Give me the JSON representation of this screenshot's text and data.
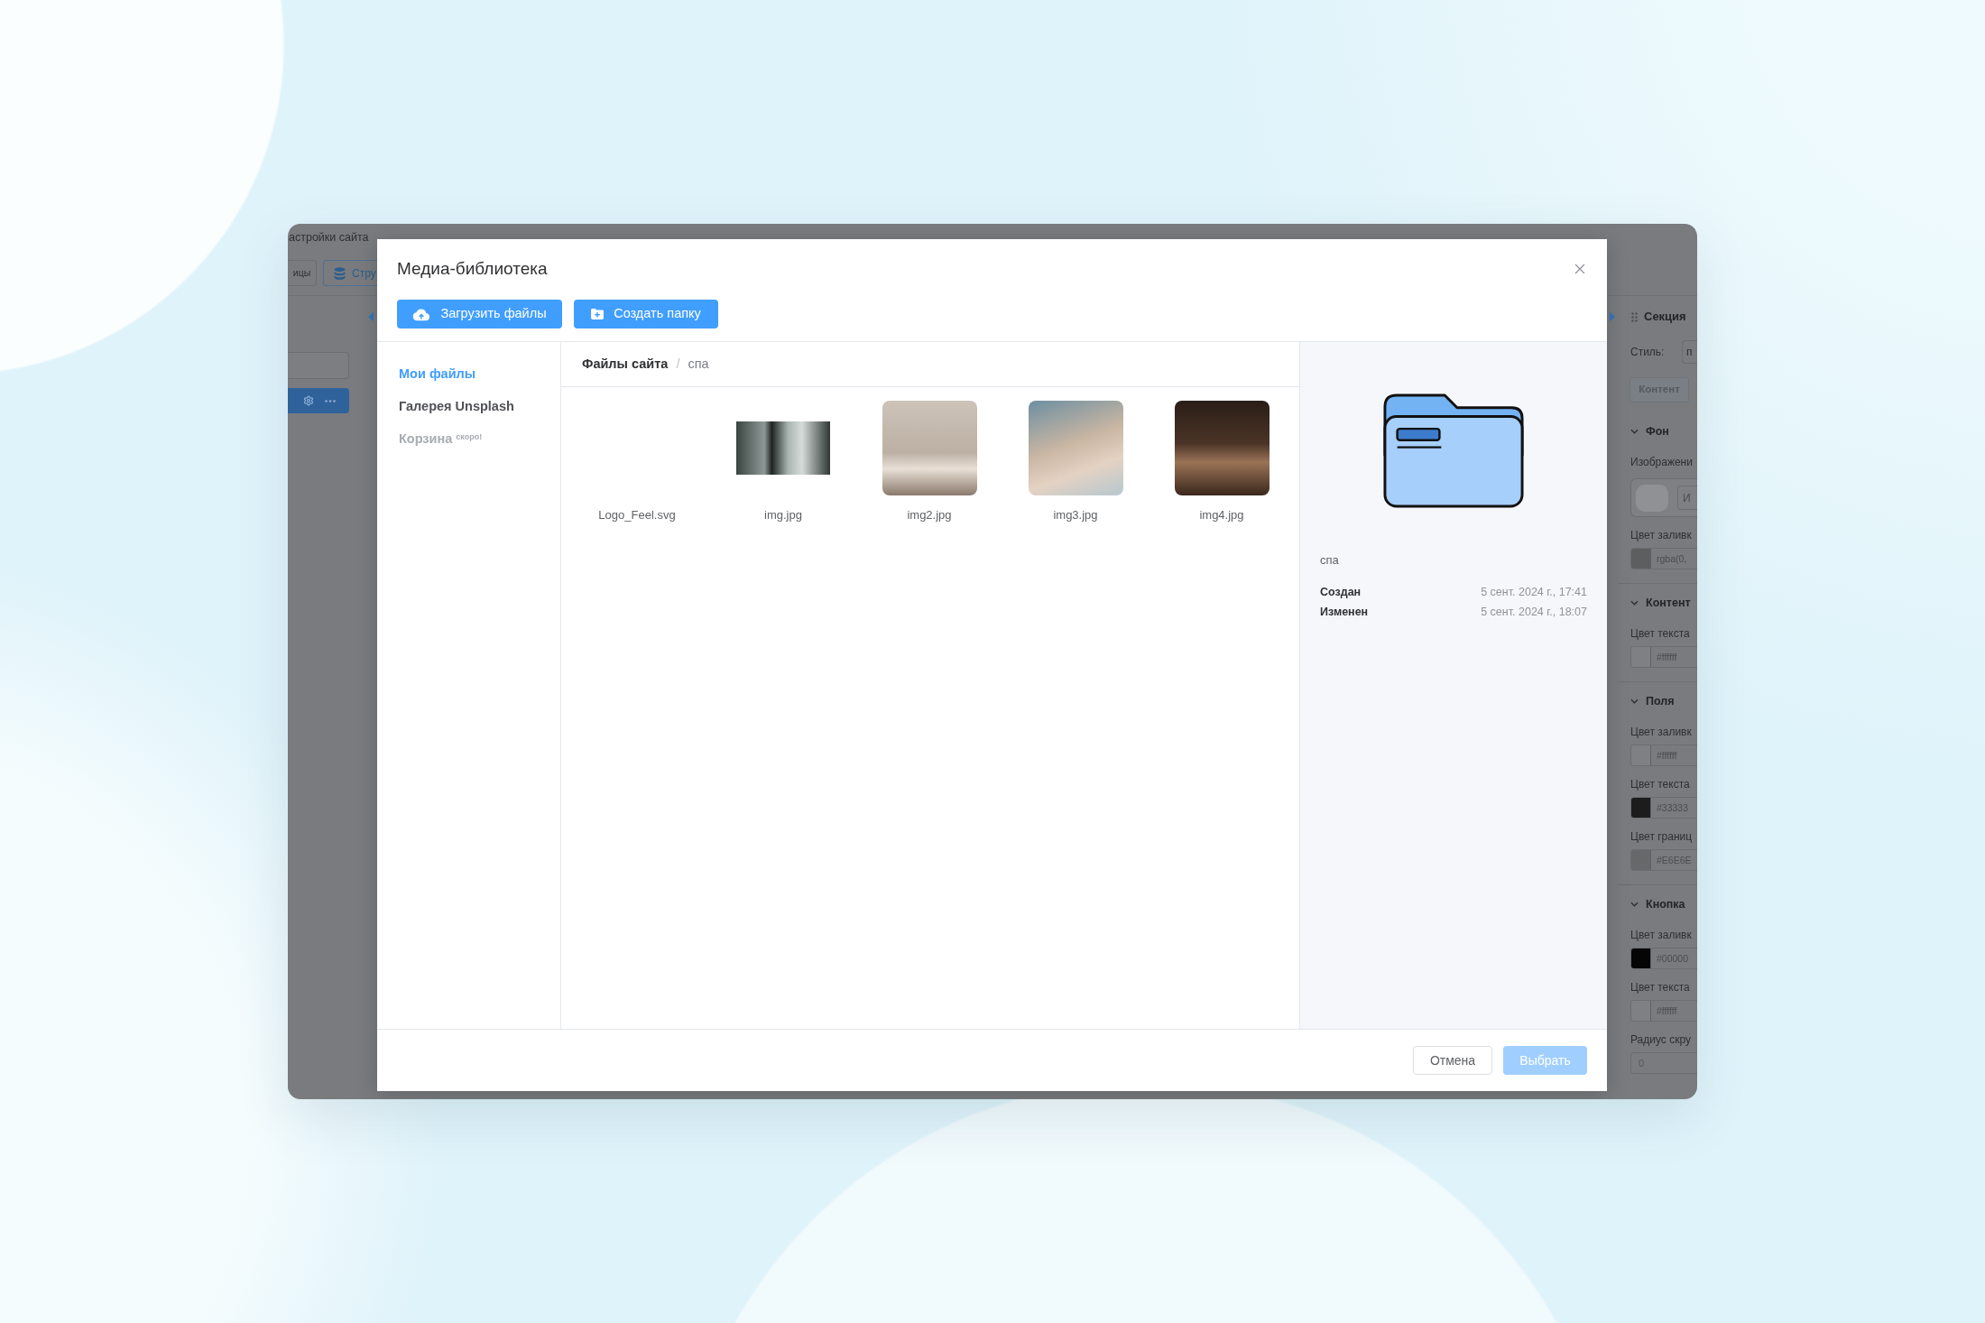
{
  "background_app": {
    "top_bar_title": "астройки сайта",
    "toolbar_buttons": [
      {
        "label": "ицы",
        "kind": "plain"
      },
      {
        "label": "Стру",
        "kind": "layers"
      }
    ],
    "settings_panel": {
      "title": "Секция",
      "style_label": "Стиль:",
      "style_value": "п",
      "tab": "Контент",
      "sections": [
        {
          "title": "Фон",
          "expanded": true,
          "fields": [
            {
              "kind": "image",
              "label": "Изображени",
              "value": "И"
            },
            {
              "kind": "color",
              "label": "Цвет заливк",
              "value": "rgba(0,",
              "color": "#5d5e60"
            }
          ]
        },
        {
          "title": "Контент",
          "expanded": true,
          "fields": [
            {
              "kind": "color",
              "label": "Цвет текста",
              "value": "#ffffff",
              "color": "#7e8083"
            }
          ]
        },
        {
          "title": "Поля",
          "expanded": true,
          "fields": [
            {
              "kind": "color",
              "label": "Цвет заливк",
              "value": "#ffffff",
              "color": "#7e8083"
            },
            {
              "kind": "color",
              "label": "Цвет текста",
              "value": "#33333",
              "color": "#1c1c1d"
            },
            {
              "kind": "color",
              "label": "Цвет границ",
              "value": "#E6E6E",
              "color": "#67686a"
            }
          ]
        },
        {
          "title": "Кнопка",
          "expanded": true,
          "fields": [
            {
              "kind": "color",
              "label": "Цвет заливк",
              "value": "#00000",
              "color": "#050505"
            },
            {
              "kind": "color",
              "label": "Цвет текста",
              "value": "#ffffff",
              "color": "#7e8083"
            },
            {
              "kind": "number",
              "label": "Радиус скру",
              "value": "0"
            }
          ]
        }
      ]
    }
  },
  "dialog": {
    "title": "Медиа-библиотека",
    "actions": [
      {
        "label": "Загрузить файлы"
      },
      {
        "label": "Создать папку"
      }
    ],
    "nav": [
      {
        "label": "Мои файлы",
        "selected": true,
        "disabled": false
      },
      {
        "label": "Галерея Unsplash",
        "selected": false,
        "disabled": false
      },
      {
        "label": "Корзина",
        "badge": "скоро!",
        "selected": false,
        "disabled": true
      }
    ],
    "breadcrumb": {
      "items": [
        {
          "label": "Файлы сайта",
          "current": false
        },
        {
          "label": "спа",
          "current": true
        }
      ],
      "separator": "/"
    },
    "files": [
      {
        "name": "Logo_Feel.svg",
        "kind": "blank"
      },
      {
        "name": "img.jpg",
        "kind": "landscape"
      },
      {
        "name": "img2.jpg",
        "kind": "square"
      },
      {
        "name": "img3.jpg",
        "kind": "square"
      },
      {
        "name": "img4.jpg",
        "kind": "square"
      }
    ],
    "details": {
      "name": "спа",
      "meta": [
        {
          "label": "Создан",
          "value": "5 сент. 2024 г., 17:41"
        },
        {
          "label": "Изменен",
          "value": "5 сент. 2024 г., 18:07"
        }
      ]
    },
    "footer_buttons": [
      {
        "label": "Отмена",
        "kind": "secondary",
        "disabled": false
      },
      {
        "label": "Выбрать",
        "kind": "primary",
        "disabled": true
      }
    ]
  }
}
